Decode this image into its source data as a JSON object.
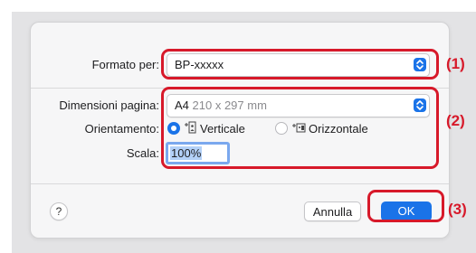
{
  "dialog": {
    "paper_format": {
      "label": "Formato per:",
      "value": "BP-xxxxx"
    },
    "page_size": {
      "label": "Dimensioni pagina:",
      "value": "A4",
      "detail": "210 x 297 mm"
    },
    "orientation": {
      "label": "Orientamento:",
      "options": [
        {
          "label": "Verticale",
          "selected": true
        },
        {
          "label": "Orizzontale",
          "selected": false
        }
      ]
    },
    "scale": {
      "label": "Scala:",
      "value": "100%"
    },
    "help_label": "?",
    "cancel_label": "Annulla",
    "ok_label": "OK"
  },
  "callouts": [
    "(1)",
    "(2)",
    "(3)"
  ],
  "colors": {
    "accent": "#1a73e8",
    "callout": "#d7192a"
  }
}
